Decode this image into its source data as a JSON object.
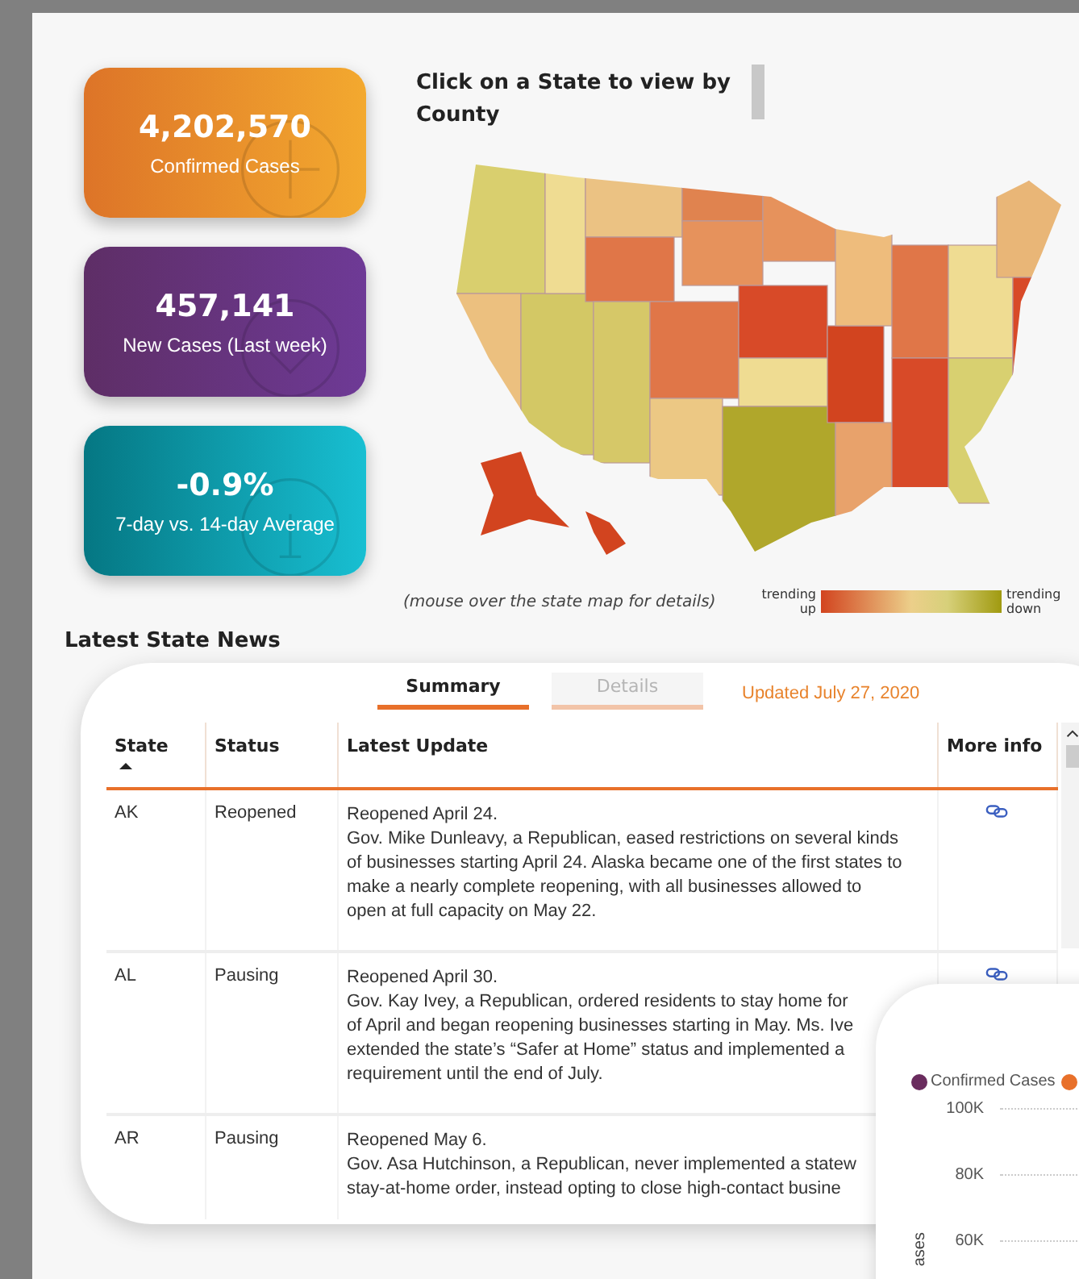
{
  "stat_cards": [
    {
      "kind": "confirmed",
      "value": "4,202,570",
      "label": "Confirmed Cases"
    },
    {
      "kind": "new",
      "value": "457,141",
      "label": "New Cases (Last week)"
    },
    {
      "kind": "trend",
      "value": "-0.9%",
      "label": "7-day vs. 14-day Average"
    }
  ],
  "map": {
    "title": "Click on a State to view by County",
    "caption": "(mouse over the state map for details)",
    "legend": {
      "low_label": "trending up",
      "high_label": "trending down"
    }
  },
  "news": {
    "title": "Latest State News",
    "tabs": [
      {
        "label": "Summary",
        "selected": true
      },
      {
        "label": "Details",
        "selected": false
      }
    ],
    "updated": "Updated July 27, 2020",
    "table": {
      "columns": [
        {
          "label": "State",
          "sorted": true
        },
        {
          "label": "Status",
          "sorted": false
        },
        {
          "label": "Latest Update",
          "sorted": false
        },
        {
          "label": "More info",
          "sorted": false
        }
      ],
      "rows": [
        {
          "state": "AK",
          "status": "Reopened",
          "update": [
            "Reopened April 24.",
            "Gov. Mike Dunleavy, a Republican, eased restrictions on several kinds",
            "of businesses starting April 24. Alaska became one of the first states to",
            "make a nearly complete reopening, with all businesses allowed to",
            "open at full capacity on May 22."
          ],
          "link": true
        },
        {
          "state": "AL",
          "status": "Pausing",
          "update": [
            "Reopened April 30.",
            "Gov. Kay Ivey, a Republican, ordered residents to stay home for",
            "of April and began reopening businesses starting in May. Ms. Ive",
            "extended the state’s “Safer at Home” status and implemented a",
            "requirement until the end of July."
          ],
          "link": true
        },
        {
          "state": "AR",
          "status": "Pausing",
          "update": [
            "Reopened May 6.",
            "Gov. Asa Hutchinson, a Republican, never implemented a statew",
            "stay-at-home order, instead opting to close high-contact busine"
          ]
        }
      ]
    }
  },
  "chart_panel": {
    "legend": [
      {
        "label": "Confirmed Cases",
        "color": "#6a2c5e"
      },
      {
        "color": "#e8702a"
      }
    ],
    "yticks": [
      "100K",
      "80K",
      "60K"
    ],
    "ylabel": "ases"
  }
}
